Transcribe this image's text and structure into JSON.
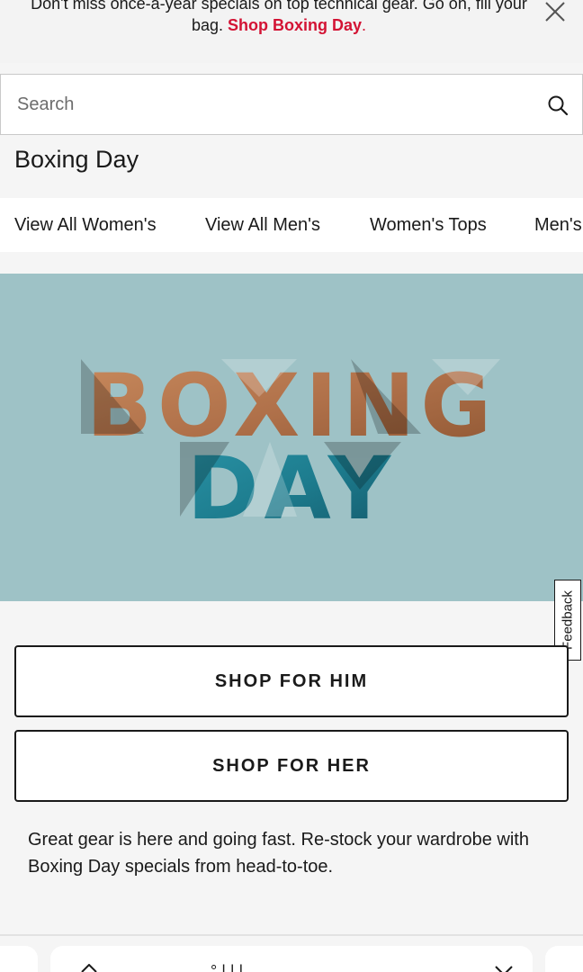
{
  "promo": {
    "text": "Don't miss once-a-year specials on top technical gear. Go on, fill your bag.",
    "link_label": "Shop Boxing Day",
    "link_suffix": "."
  },
  "search": {
    "placeholder": "Search"
  },
  "page": {
    "title": "Boxing Day"
  },
  "category_nav": {
    "items": [
      {
        "label": "View All Women's"
      },
      {
        "label": "View All Men's"
      },
      {
        "label": "Women's Tops"
      },
      {
        "label": "Men's"
      }
    ]
  },
  "hero": {
    "line1": "BOXING",
    "line2": "DAY",
    "background_color": "#9ec2c6",
    "line1_color": "#b97a4e",
    "line2_color": "#1f7d8f"
  },
  "feedback": {
    "label": "Feedback"
  },
  "actions": {
    "shop_him_label": "SHOP FOR HIM",
    "shop_her_label": "SHOP FOR HER"
  },
  "description": {
    "text": "Great gear is here and going fast. Re-stock your wardrobe with Boxing Day specials from head-to-toe."
  },
  "bottom_card": {
    "partial_text": "° | | |"
  }
}
